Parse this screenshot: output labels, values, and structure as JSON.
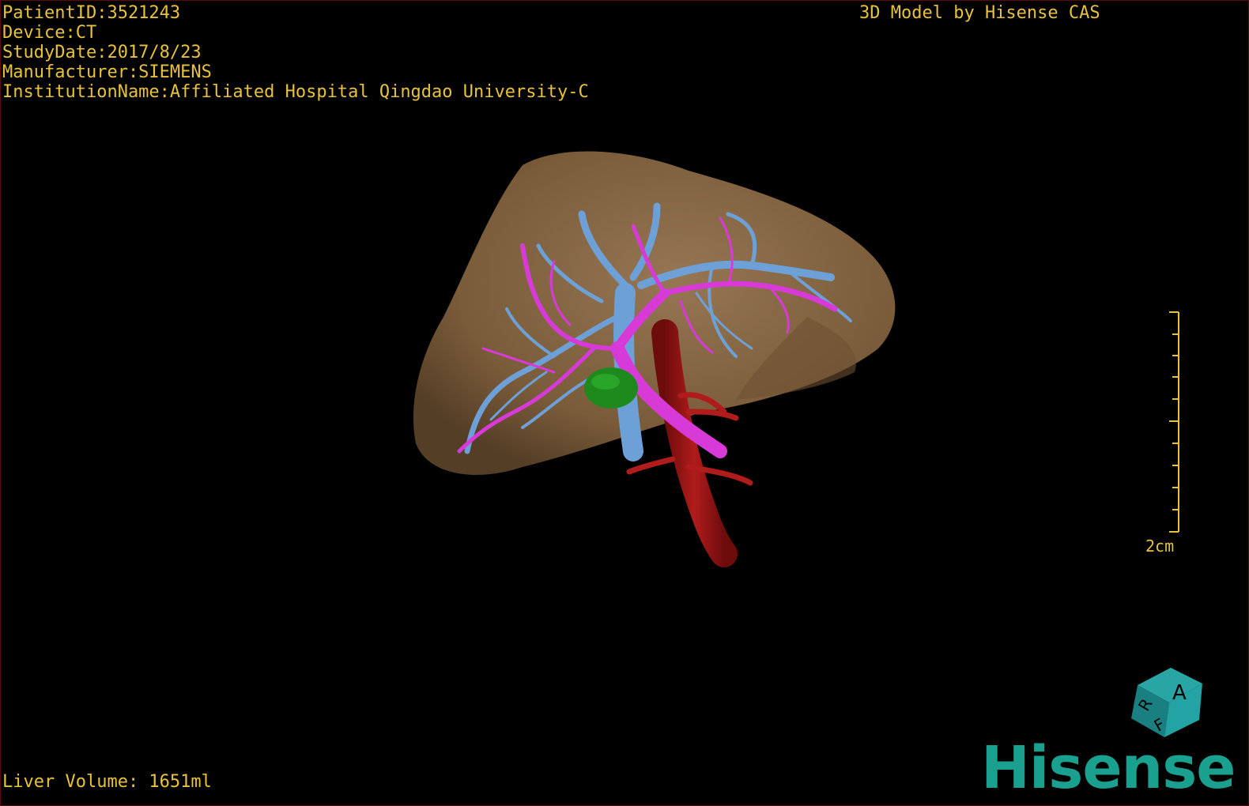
{
  "patient_info": {
    "patient_id": "PatientID:3521243",
    "device": "Device:CT",
    "study_date": "StudyDate:2017/8/23",
    "manufacturer": "Manufacturer:SIEMENS",
    "institution": "InstitutionName:Affiliated Hospital Qingdao University-C"
  },
  "credit": "3D Model by Hisense CAS",
  "liver_volume": "Liver Volume: 1651ml",
  "scale_bar": {
    "label": "2cm"
  },
  "orientation_cube": {
    "face_top": "A",
    "face_left": "R",
    "face_bottom": "F"
  },
  "brand": "Hisense",
  "colors": {
    "overlay_text": "#e8c23a",
    "liver": "#8a6a48",
    "hepatic_vein": "#6ea0d8",
    "portal_vein": "#d83ad8",
    "artery": "#a01818",
    "gallbladder": "#1e8a1e",
    "brand": "#1aa08f"
  }
}
